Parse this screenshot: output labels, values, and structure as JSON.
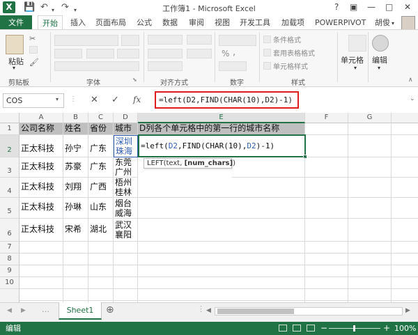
{
  "window": {
    "title": "工作簿1 - Microsoft Excel",
    "logo": "X",
    "help": "?",
    "minimize": "—",
    "maximize": "□",
    "close": "✕",
    "ribbon_opts": "▣"
  },
  "qat": {
    "save": "💾",
    "undo": "↶",
    "redo": "↷"
  },
  "tabs": {
    "file": "文件",
    "items": [
      "开始",
      "插入",
      "页面布局",
      "公式",
      "数据",
      "审阅",
      "视图",
      "开发工具",
      "加载项",
      "POWERPIVOT"
    ],
    "user": "胡俊"
  },
  "ribbon": {
    "paste": "粘贴",
    "clipboard": "剪贴板",
    "font": "字体",
    "alignment": "对齐方式",
    "number": "数字",
    "styles": "样式",
    "conditional_format": "条件格式",
    "table_format": "套用表格格式",
    "cell_styles": "单元格样式",
    "cells": "单元格",
    "editing": "编辑",
    "percent": "%",
    "comma": ","
  },
  "formula_bar": {
    "name_box": "COS",
    "cancel": "✕",
    "enter": "✓",
    "fx": "fx",
    "formula": "=left(D2,FIND(CHAR(10),D2)-1)"
  },
  "columns": [
    "A",
    "B",
    "C",
    "D",
    "E",
    "F",
    "G"
  ],
  "rows": [
    "1",
    "2",
    "3",
    "4",
    "5",
    "6",
    "7",
    "8",
    "9",
    "10"
  ],
  "header_row": {
    "a": "公司名称",
    "b": "姓名",
    "c": "省份",
    "d": "城市",
    "e": "D列各个单元格中的第一行的城市名称"
  },
  "data_rows": [
    {
      "a": "正太科技",
      "b": "孙宁",
      "c": "广东",
      "d1": "深圳",
      "d2": "珠海"
    },
    {
      "a": "正太科技",
      "b": "苏豪",
      "c": "广东",
      "d1": "东莞",
      "d2": "广州"
    },
    {
      "a": "正太科技",
      "b": "刘翔",
      "c": "广西",
      "d1": "梧州",
      "d2": "桂林"
    },
    {
      "a": "正太科技",
      "b": "孙琳",
      "c": "山东",
      "d1": "烟台",
      "d2": "威海"
    },
    {
      "a": "正太科技",
      "b": "宋希",
      "c": "湖北",
      "d1": "武汉",
      "d2": "襄阳"
    }
  ],
  "edit_cell": {
    "f1": "=left(",
    "ref1": "D2",
    "f2": ",FIND(CHAR(10),",
    "ref2": "D2",
    "f3": ")-1)"
  },
  "tooltip": {
    "prefix": "LEFT(text, ",
    "bold": "[num_chars]",
    "suffix": ")"
  },
  "sheets": {
    "active": "Sheet1",
    "add": "⊕",
    "prev": "◀",
    "next": "▶",
    "ellipsis": "…"
  },
  "status": {
    "mode": "编辑",
    "zoom": "100%",
    "zoom_minus": "−",
    "zoom_plus": "+"
  },
  "colors": {
    "accent": "#217346",
    "highlight": "#e21d1d",
    "ref_blue": "#2f5eb3"
  }
}
